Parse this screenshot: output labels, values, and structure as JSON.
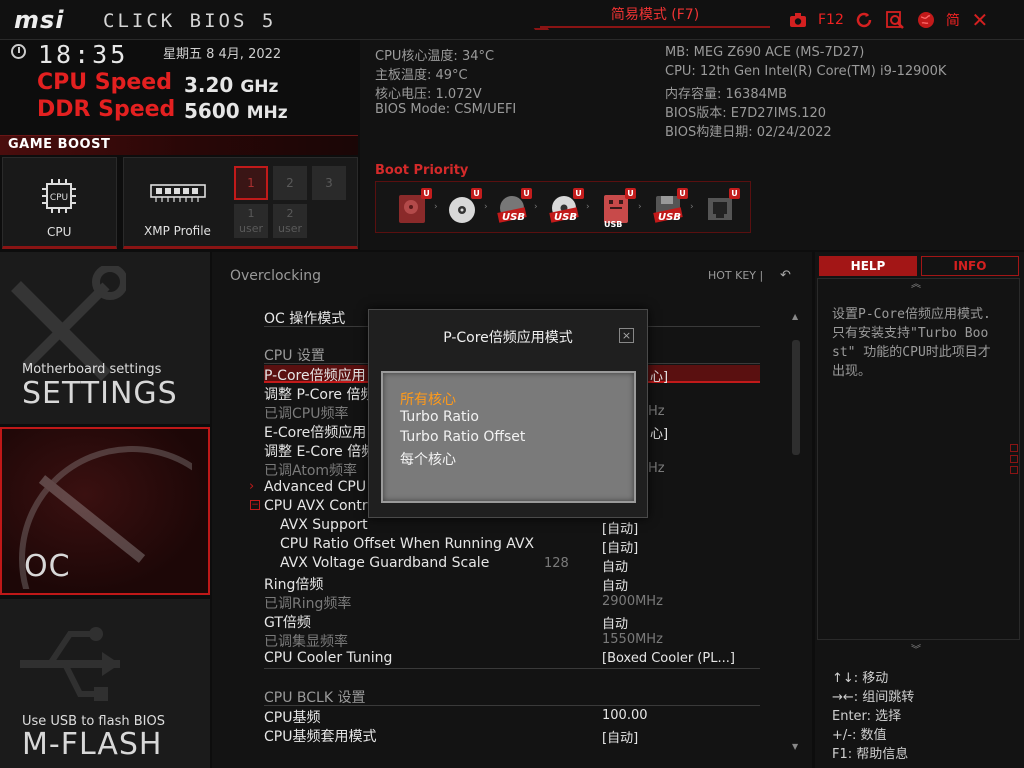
{
  "header": {
    "logo": "msi",
    "title": "CLICK BIOS 5",
    "easy_mode": "简易模式 (F7)",
    "screenshot_key": "F12",
    "language": "简"
  },
  "status": {
    "time": "18:35",
    "date": "星期五  8 4月, 2022",
    "cpu_speed_label": "CPU Speed",
    "cpu_speed_value": "3.20",
    "cpu_speed_unit": "GHz",
    "ddr_speed_label": "DDR Speed",
    "ddr_speed_value": "5600",
    "ddr_speed_unit": "MHz"
  },
  "sysinfo": {
    "left": [
      "CPU核心温度: 34°C",
      "主板温度: 49°C",
      "核心电压: 1.072V",
      "BIOS Mode: CSM/UEFI"
    ],
    "right": [
      "MB: MEG Z690 ACE (MS-7D27)",
      "CPU: 12th Gen Intel(R) Core(TM) i9-12900K",
      "内存容量: 16384MB",
      "BIOS版本: E7D27IMS.120",
      "BIOS构建日期: 02/24/2022"
    ]
  },
  "boot": {
    "label": "Boot Priority",
    "badge": "U",
    "usb_label": "USB"
  },
  "game_boost": {
    "label": "GAME BOOST",
    "cpu_label": "CPU",
    "xmp_label": "XMP Profile",
    "xmp_profiles": [
      "1",
      "2",
      "3"
    ],
    "user_profiles": [
      "1",
      "2"
    ],
    "user_word": "user"
  },
  "nav": {
    "settings_small": "Motherboard settings",
    "settings_big": "SETTINGS",
    "oc_big": "OC",
    "mflash_small": "Use USB to flash BIOS",
    "mflash_big": "M-FLASH"
  },
  "main": {
    "breadcrumb": "Overclocking",
    "hotkey": "HOT KEY  |",
    "rows": {
      "oc_mode": "OC 操作模式",
      "cpu_settings": "CPU  设置",
      "pcore_apply": "P-Core倍频应用",
      "pcore_apply_val": "心]",
      "adjust_pcore": "调整 P-Core 倍频",
      "adjusted_cpu": "已调CPU频率",
      "adjusted_cpu_val": "Hz",
      "ecore_apply": "E-Core倍频应用",
      "ecore_apply_val": "心]",
      "adjust_ecore": "调整 E-Core 倍频",
      "adjusted_atom": "已调Atom频率",
      "adjusted_atom_val": "Hz",
      "adv_cpu": "Advanced CPU C",
      "avx_ctrl": "CPU AVX Contro",
      "avx_support": "AVX Support",
      "avx_support_val": "[自动]",
      "avx_offset": "CPU Ratio Offset When Running AVX",
      "avx_offset_val": "[自动]",
      "avx_guard": "AVX Voltage Guardband Scale",
      "avx_guard_num": "128",
      "avx_guard_val": "自动",
      "ring": "Ring倍频",
      "ring_val": "自动",
      "adj_ring": "已调Ring频率",
      "adj_ring_val": "2900MHz",
      "gt": "GT倍频",
      "gt_val": "自动",
      "adj_gt": "已调集显频率",
      "adj_gt_val": "1550MHz",
      "cooler": "CPU Cooler Tuning",
      "cooler_val": "[Boxed Cooler (PL...]",
      "bclk_settings": "CPU  BCLK  设置",
      "bclk": "CPU基频",
      "bclk_val": "100.00",
      "bclk_mode": "CPU基频套用模式",
      "bclk_mode_val": "[自动]"
    }
  },
  "modal": {
    "title": "P-Core倍频应用模式",
    "close": "×",
    "options": [
      "所有核心",
      "Turbo Ratio",
      "Turbo Ratio Offset",
      "每个核心"
    ],
    "selected_index": 0
  },
  "help": {
    "tab_help": "HELP",
    "tab_info": "INFO",
    "text": "设置P-Core倍频应用模式.只有安装支持\"Turbo Boost\" 功能的CPU时此项目才出现。",
    "keys": [
      "↑↓: 移动",
      "→←: 组间跳转",
      "Enter: 选择",
      "+/-: 数值",
      "F1: 帮助信息"
    ]
  },
  "colors": {
    "accent_red": "#c21a1a",
    "selected_orange": "#ff9a1a"
  }
}
